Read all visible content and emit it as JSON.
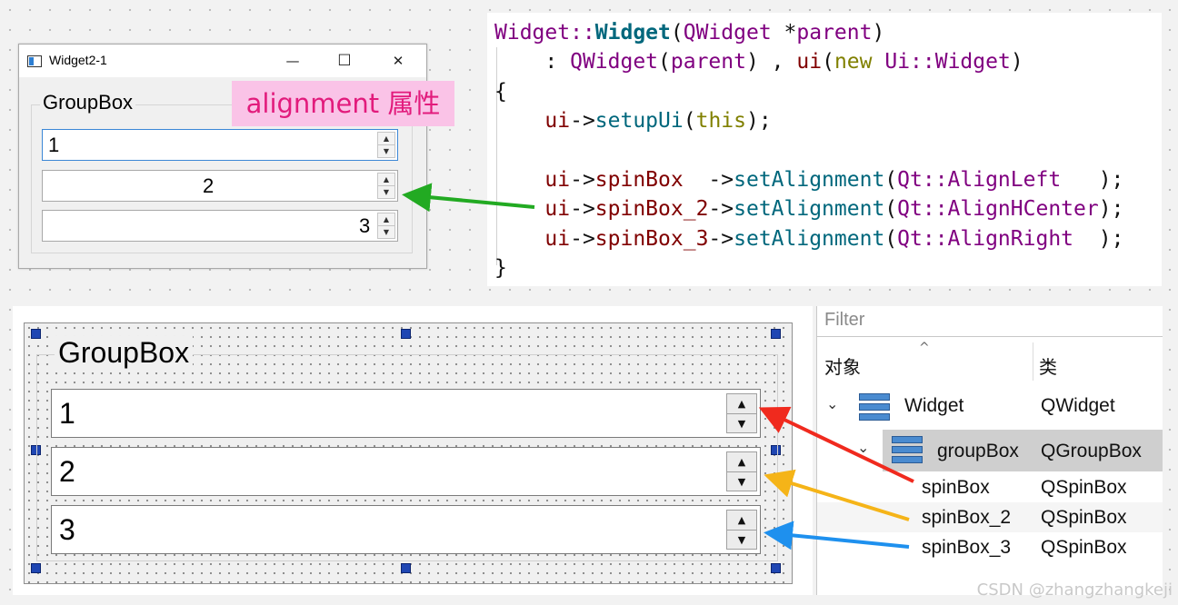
{
  "window": {
    "title": "Widget2-1",
    "controls": {
      "minimize": "—",
      "maximize": "☐",
      "close": "✕"
    },
    "groupbox_title": "GroupBox",
    "spinboxes": [
      {
        "value": "1",
        "align": "left"
      },
      {
        "value": "2",
        "align": "center"
      },
      {
        "value": "3",
        "align": "right"
      }
    ],
    "spin_up": "▲",
    "spin_down": "▼"
  },
  "badge": "alignment 属性",
  "code": {
    "lines": [
      "Widget::Widget(QWidget *parent)",
      "    : QWidget(parent) , ui(new Ui::Widget)",
      "{",
      "    ui->setupUi(this);",
      "",
      "    ui->spinBox  ->setAlignment(Qt::AlignLeft   );",
      "    ui->spinBox_2->setAlignment(Qt::AlignHCenter);",
      "    ui->spinBox_3->setAlignment(Qt::AlignRight  );",
      "}"
    ]
  },
  "designer": {
    "groupbox_title": "GroupBox",
    "spinboxes": [
      "1",
      "2",
      "3"
    ]
  },
  "inspector": {
    "filter_placeholder": "Filter",
    "col_object": "对象",
    "col_class": "类",
    "sort_indicator": "^",
    "rows": [
      {
        "name": "Widget",
        "class": "QWidget",
        "expand": "⌄"
      },
      {
        "name": "groupBox",
        "class": "QGroupBox",
        "expand": "⌄"
      },
      {
        "name": "spinBox",
        "class": "QSpinBox"
      },
      {
        "name": "spinBox_2",
        "class": "QSpinBox"
      },
      {
        "name": "spinBox_3",
        "class": "QSpinBox"
      }
    ]
  },
  "watermark": "CSDN @zhangzhangkeji",
  "colors": {
    "arrow_green": "#22aa22",
    "arrow_red": "#f02a1e",
    "arrow_yellow": "#f5b418",
    "arrow_blue": "#1e90ee",
    "badge_bg": "#fac3e7",
    "badge_text": "#e21b7c"
  }
}
